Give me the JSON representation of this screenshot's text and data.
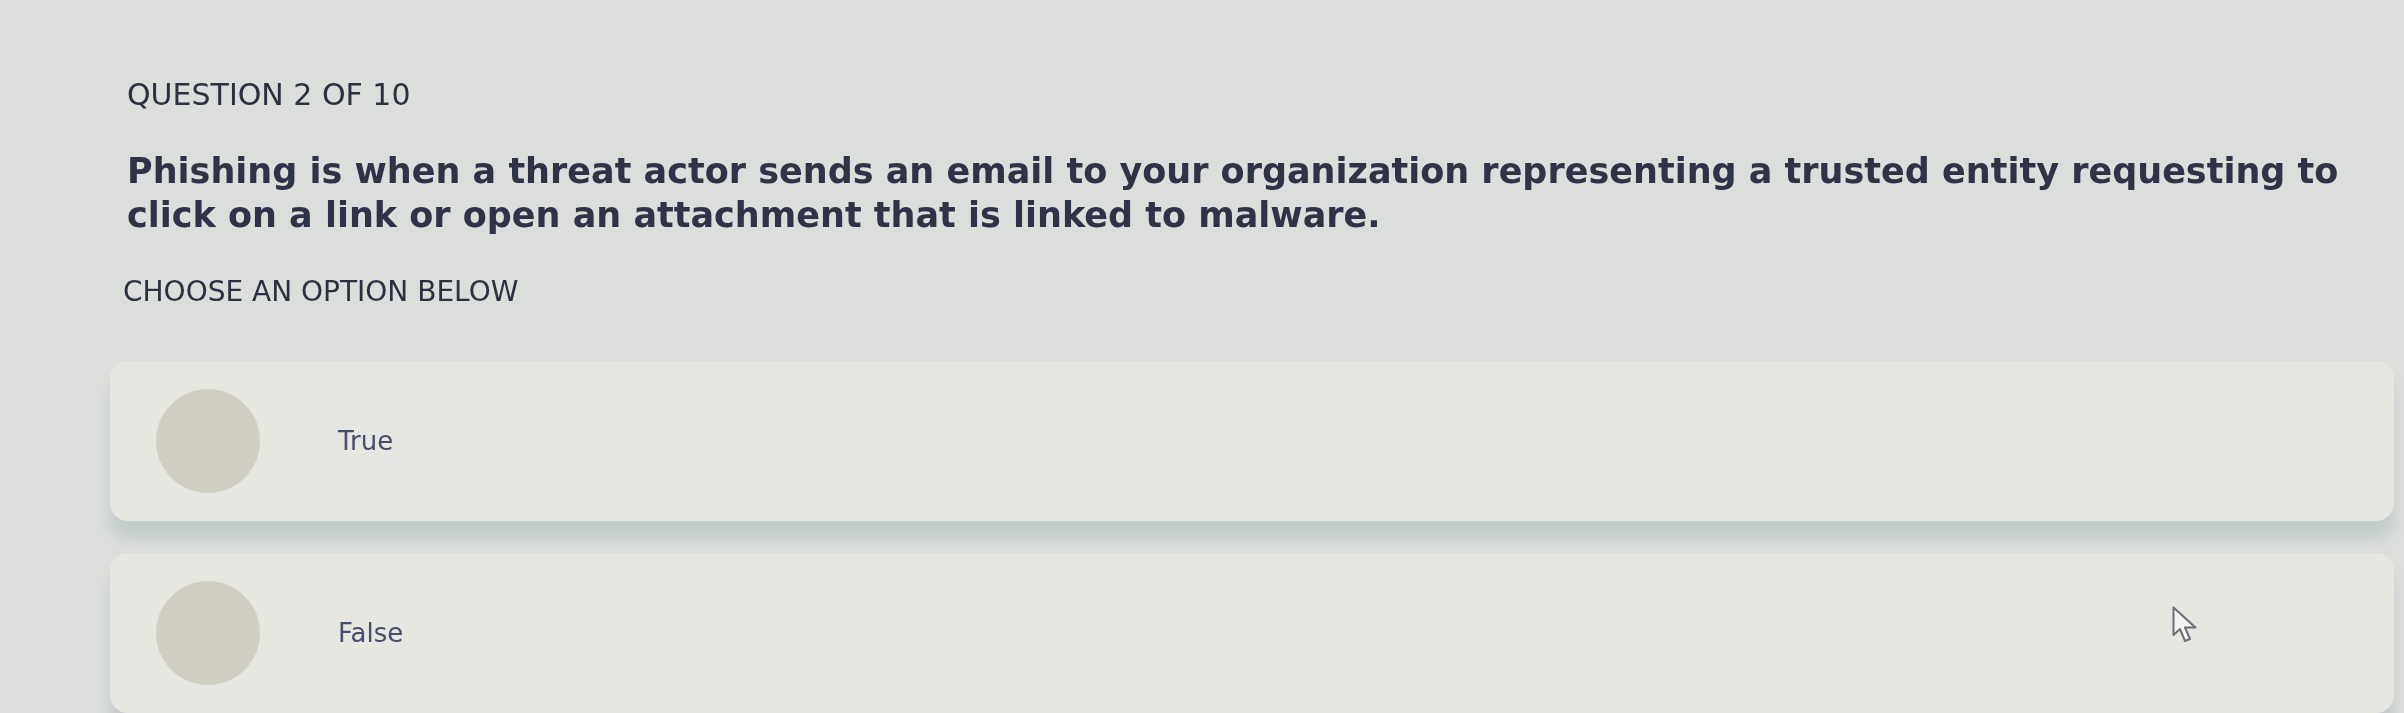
{
  "question": {
    "counter": "QUESTION 2 OF 10",
    "text": "Phishing is when a threat actor sends an email to your organization representing a trusted entity requesting to click on a link or open an attachment that is linked to malware."
  },
  "prompt": "CHOOSE AN OPTION BELOW",
  "options": [
    {
      "label": "True",
      "selected": false
    },
    {
      "label": "False",
      "selected": false
    }
  ]
}
